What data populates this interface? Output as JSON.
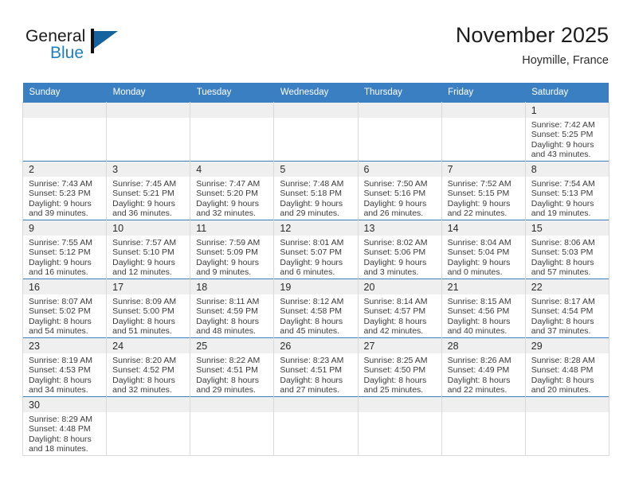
{
  "brand": {
    "name_top": "General",
    "name_bottom": "Blue",
    "flag_icon": "blue-flag-triangle-icon",
    "color_blue": "#1f7fc4",
    "color_dark": "#1b1b1b"
  },
  "header": {
    "title": "November 2025",
    "subtitle": "Hoymille, France"
  },
  "theme": {
    "header_bg": "#3a7fc1",
    "header_text": "#ffffff",
    "daynum_band_bg": "#efefef",
    "cell_bg": "#ffffff",
    "row_rule": "#3a7fc1",
    "cell_border": "#d9d9d9"
  },
  "weekday_headers": [
    "Sunday",
    "Monday",
    "Tuesday",
    "Wednesday",
    "Thursday",
    "Friday",
    "Saturday"
  ],
  "weeks": [
    [
      {
        "blank": true
      },
      {
        "blank": true
      },
      {
        "blank": true
      },
      {
        "blank": true
      },
      {
        "blank": true
      },
      {
        "blank": true
      },
      {
        "day": "1",
        "sunrise": "Sunrise: 7:42 AM",
        "sunset": "Sunset: 5:25 PM",
        "daylight1": "Daylight: 9 hours",
        "daylight2": "and 43 minutes."
      }
    ],
    [
      {
        "day": "2",
        "sunrise": "Sunrise: 7:43 AM",
        "sunset": "Sunset: 5:23 PM",
        "daylight1": "Daylight: 9 hours",
        "daylight2": "and 39 minutes."
      },
      {
        "day": "3",
        "sunrise": "Sunrise: 7:45 AM",
        "sunset": "Sunset: 5:21 PM",
        "daylight1": "Daylight: 9 hours",
        "daylight2": "and 36 minutes."
      },
      {
        "day": "4",
        "sunrise": "Sunrise: 7:47 AM",
        "sunset": "Sunset: 5:20 PM",
        "daylight1": "Daylight: 9 hours",
        "daylight2": "and 32 minutes."
      },
      {
        "day": "5",
        "sunrise": "Sunrise: 7:48 AM",
        "sunset": "Sunset: 5:18 PM",
        "daylight1": "Daylight: 9 hours",
        "daylight2": "and 29 minutes."
      },
      {
        "day": "6",
        "sunrise": "Sunrise: 7:50 AM",
        "sunset": "Sunset: 5:16 PM",
        "daylight1": "Daylight: 9 hours",
        "daylight2": "and 26 minutes."
      },
      {
        "day": "7",
        "sunrise": "Sunrise: 7:52 AM",
        "sunset": "Sunset: 5:15 PM",
        "daylight1": "Daylight: 9 hours",
        "daylight2": "and 22 minutes."
      },
      {
        "day": "8",
        "sunrise": "Sunrise: 7:54 AM",
        "sunset": "Sunset: 5:13 PM",
        "daylight1": "Daylight: 9 hours",
        "daylight2": "and 19 minutes."
      }
    ],
    [
      {
        "day": "9",
        "sunrise": "Sunrise: 7:55 AM",
        "sunset": "Sunset: 5:12 PM",
        "daylight1": "Daylight: 9 hours",
        "daylight2": "and 16 minutes."
      },
      {
        "day": "10",
        "sunrise": "Sunrise: 7:57 AM",
        "sunset": "Sunset: 5:10 PM",
        "daylight1": "Daylight: 9 hours",
        "daylight2": "and 12 minutes."
      },
      {
        "day": "11",
        "sunrise": "Sunrise: 7:59 AM",
        "sunset": "Sunset: 5:09 PM",
        "daylight1": "Daylight: 9 hours",
        "daylight2": "and 9 minutes."
      },
      {
        "day": "12",
        "sunrise": "Sunrise: 8:01 AM",
        "sunset": "Sunset: 5:07 PM",
        "daylight1": "Daylight: 9 hours",
        "daylight2": "and 6 minutes."
      },
      {
        "day": "13",
        "sunrise": "Sunrise: 8:02 AM",
        "sunset": "Sunset: 5:06 PM",
        "daylight1": "Daylight: 9 hours",
        "daylight2": "and 3 minutes."
      },
      {
        "day": "14",
        "sunrise": "Sunrise: 8:04 AM",
        "sunset": "Sunset: 5:04 PM",
        "daylight1": "Daylight: 9 hours",
        "daylight2": "and 0 minutes."
      },
      {
        "day": "15",
        "sunrise": "Sunrise: 8:06 AM",
        "sunset": "Sunset: 5:03 PM",
        "daylight1": "Daylight: 8 hours",
        "daylight2": "and 57 minutes."
      }
    ],
    [
      {
        "day": "16",
        "sunrise": "Sunrise: 8:07 AM",
        "sunset": "Sunset: 5:02 PM",
        "daylight1": "Daylight: 8 hours",
        "daylight2": "and 54 minutes."
      },
      {
        "day": "17",
        "sunrise": "Sunrise: 8:09 AM",
        "sunset": "Sunset: 5:00 PM",
        "daylight1": "Daylight: 8 hours",
        "daylight2": "and 51 minutes."
      },
      {
        "day": "18",
        "sunrise": "Sunrise: 8:11 AM",
        "sunset": "Sunset: 4:59 PM",
        "daylight1": "Daylight: 8 hours",
        "daylight2": "and 48 minutes."
      },
      {
        "day": "19",
        "sunrise": "Sunrise: 8:12 AM",
        "sunset": "Sunset: 4:58 PM",
        "daylight1": "Daylight: 8 hours",
        "daylight2": "and 45 minutes."
      },
      {
        "day": "20",
        "sunrise": "Sunrise: 8:14 AM",
        "sunset": "Sunset: 4:57 PM",
        "daylight1": "Daylight: 8 hours",
        "daylight2": "and 42 minutes."
      },
      {
        "day": "21",
        "sunrise": "Sunrise: 8:15 AM",
        "sunset": "Sunset: 4:56 PM",
        "daylight1": "Daylight: 8 hours",
        "daylight2": "and 40 minutes."
      },
      {
        "day": "22",
        "sunrise": "Sunrise: 8:17 AM",
        "sunset": "Sunset: 4:54 PM",
        "daylight1": "Daylight: 8 hours",
        "daylight2": "and 37 minutes."
      }
    ],
    [
      {
        "day": "23",
        "sunrise": "Sunrise: 8:19 AM",
        "sunset": "Sunset: 4:53 PM",
        "daylight1": "Daylight: 8 hours",
        "daylight2": "and 34 minutes."
      },
      {
        "day": "24",
        "sunrise": "Sunrise: 8:20 AM",
        "sunset": "Sunset: 4:52 PM",
        "daylight1": "Daylight: 8 hours",
        "daylight2": "and 32 minutes."
      },
      {
        "day": "25",
        "sunrise": "Sunrise: 8:22 AM",
        "sunset": "Sunset: 4:51 PM",
        "daylight1": "Daylight: 8 hours",
        "daylight2": "and 29 minutes."
      },
      {
        "day": "26",
        "sunrise": "Sunrise: 8:23 AM",
        "sunset": "Sunset: 4:51 PM",
        "daylight1": "Daylight: 8 hours",
        "daylight2": "and 27 minutes."
      },
      {
        "day": "27",
        "sunrise": "Sunrise: 8:25 AM",
        "sunset": "Sunset: 4:50 PM",
        "daylight1": "Daylight: 8 hours",
        "daylight2": "and 25 minutes."
      },
      {
        "day": "28",
        "sunrise": "Sunrise: 8:26 AM",
        "sunset": "Sunset: 4:49 PM",
        "daylight1": "Daylight: 8 hours",
        "daylight2": "and 22 minutes."
      },
      {
        "day": "29",
        "sunrise": "Sunrise: 8:28 AM",
        "sunset": "Sunset: 4:48 PM",
        "daylight1": "Daylight: 8 hours",
        "daylight2": "and 20 minutes."
      }
    ],
    [
      {
        "day": "30",
        "sunrise": "Sunrise: 8:29 AM",
        "sunset": "Sunset: 4:48 PM",
        "daylight1": "Daylight: 8 hours",
        "daylight2": "and 18 minutes."
      },
      {
        "blank": true
      },
      {
        "blank": true
      },
      {
        "blank": true
      },
      {
        "blank": true
      },
      {
        "blank": true
      },
      {
        "blank": true
      }
    ]
  ]
}
